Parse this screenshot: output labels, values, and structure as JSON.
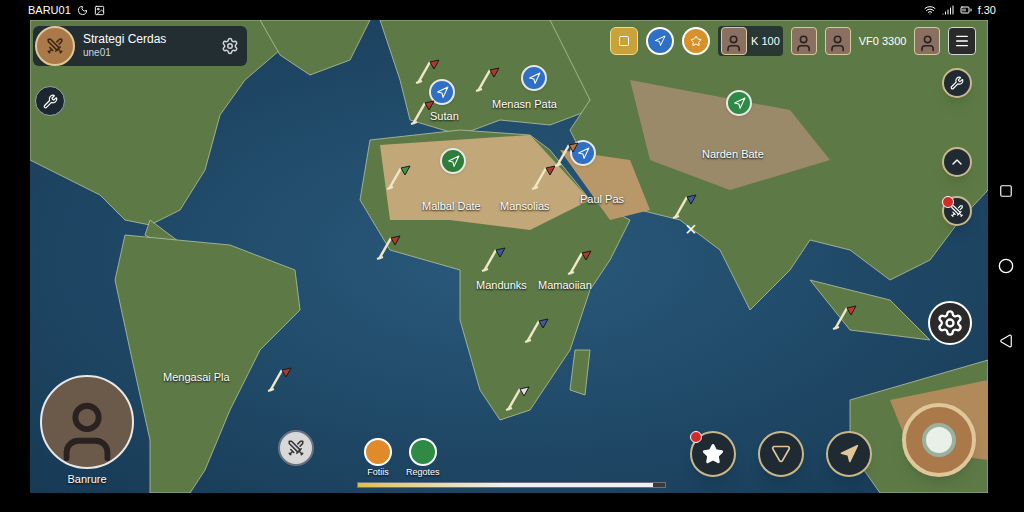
{
  "status_bar": {
    "carrier": "BARU01",
    "time": "f.30"
  },
  "profile": {
    "title": "Strategi Cerdas",
    "subtitle": "une01"
  },
  "resources": [
    {
      "text": "K 100"
    },
    {
      "text": "VF0 3300"
    }
  ],
  "map": {
    "labels": [
      "Sutan",
      "Menasn Pata",
      "Narden Bate",
      "Malbal Date",
      "Mansolias",
      "Paul Pas",
      "Mandunks",
      "Mamaoiian",
      "Mengasai Pla"
    ],
    "markers": [
      {
        "kind": "badge",
        "color": "#2f6fc4"
      },
      {
        "kind": "badge",
        "color": "#2f6fc4"
      },
      {
        "kind": "badge",
        "color": "#2e7d3a"
      },
      {
        "kind": "badge",
        "color": "#2f6fc4"
      },
      {
        "kind": "badge",
        "color": "#2e8a45"
      },
      {
        "kind": "flag",
        "color": "#b0392b"
      },
      {
        "kind": "flag",
        "color": "#b0392b"
      },
      {
        "kind": "flag",
        "color": "#b0392b"
      },
      {
        "kind": "flag",
        "color": "#3a9a4a"
      },
      {
        "kind": "flag",
        "color": "#b0392b"
      },
      {
        "kind": "flag",
        "color": "#c0703a"
      },
      {
        "kind": "flag",
        "color": "#3a5aa8"
      },
      {
        "kind": "flag",
        "color": "#b0392b"
      },
      {
        "kind": "flag",
        "color": "#3a5aa8"
      },
      {
        "kind": "flag",
        "color": "#b0392b"
      },
      {
        "kind": "flag",
        "color": "#3a5aa8"
      },
      {
        "kind": "flag",
        "color": "#e0e0e0"
      },
      {
        "kind": "flag",
        "color": "#b0392b"
      },
      {
        "kind": "flag",
        "color": "#c0392b"
      }
    ],
    "close_mark": "×"
  },
  "side_buttons": [
    {
      "alert": false
    },
    {
      "alert": false
    },
    {
      "alert": true
    }
  ],
  "commander": {
    "name": "Banrure"
  },
  "items": [
    {
      "label": "Fotiis",
      "color": "#e08a2a"
    },
    {
      "label": "Regotes",
      "color": "#2e8a45"
    }
  ],
  "progress": {
    "level": 0.96
  },
  "action_buttons": [
    {
      "alert": true
    },
    {
      "alert": false
    },
    {
      "alert": false
    }
  ]
}
